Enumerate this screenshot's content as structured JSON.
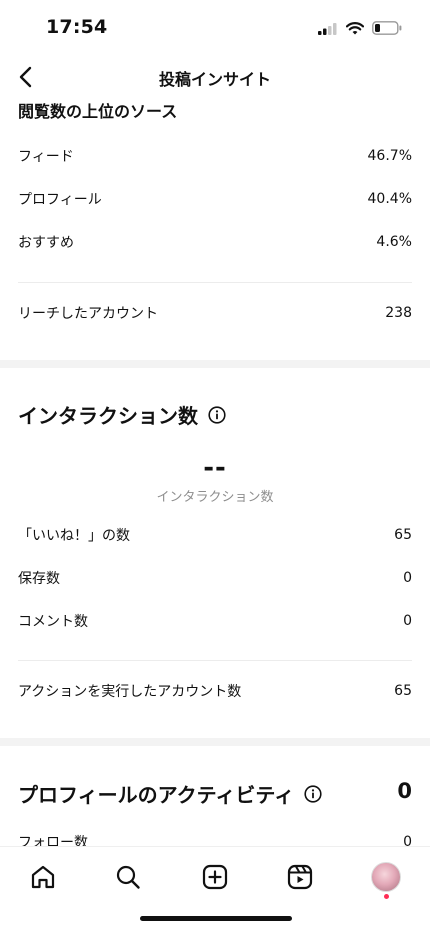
{
  "status_bar": {
    "time": "17:54"
  },
  "header": {
    "title": "投稿インサイト"
  },
  "sources": {
    "title": "閲覧数の上位のソース",
    "rows": [
      {
        "label": "フィード",
        "value": "46.7%"
      },
      {
        "label": "プロフィール",
        "value": "40.4%"
      },
      {
        "label": "おすすめ",
        "value": "4.6%"
      }
    ],
    "reach": {
      "label": "リーチしたアカウント",
      "value": "238"
    }
  },
  "interactions": {
    "title": "インタラクション数",
    "metric_value": "--",
    "metric_label": "インタラクション数",
    "rows": [
      {
        "label": "「いいね！」の数",
        "value": "65"
      },
      {
        "label": "保存数",
        "value": "0"
      },
      {
        "label": "コメント数",
        "value": "0"
      }
    ],
    "accounts": {
      "label": "アクションを実行したアカウント数",
      "value": "65"
    }
  },
  "profile_activity": {
    "title": "プロフィールのアクティビティ",
    "value": "0",
    "rows": [
      {
        "label": "フォロー数",
        "value": "0"
      }
    ]
  },
  "tab_bar": {
    "items": [
      "home-icon",
      "search-icon",
      "create-icon",
      "reels-icon",
      "profile-avatar"
    ]
  },
  "colors": {
    "accent_dot": "#ff2d55",
    "muted_text": "#8e8e8e"
  }
}
